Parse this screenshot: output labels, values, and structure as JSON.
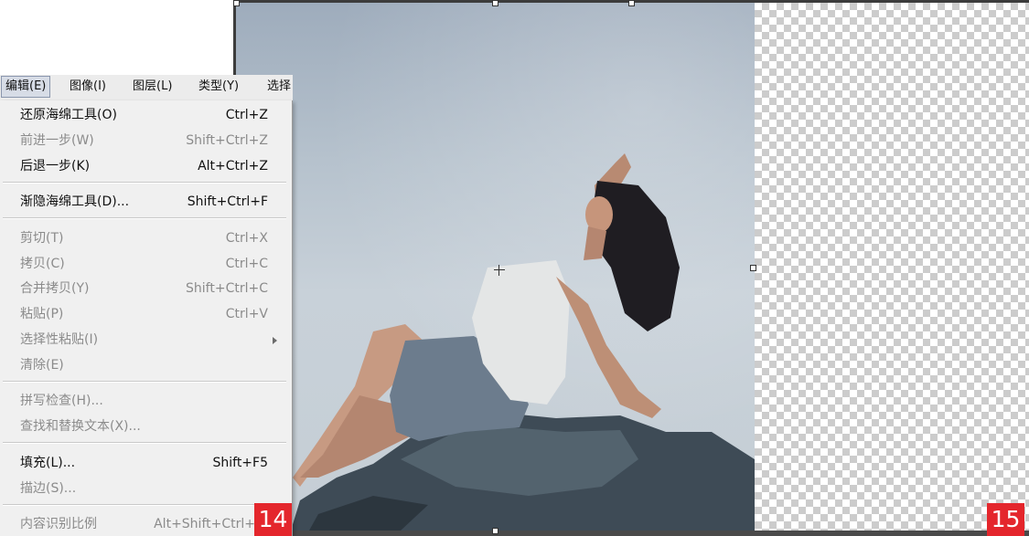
{
  "menubar": {
    "items": [
      "编辑(E)",
      "图像(I)",
      "图层(L)",
      "类型(Y)",
      "选择"
    ]
  },
  "menu": {
    "items": [
      {
        "label": "还原海绵工具(O)",
        "shortcut": "Ctrl+Z",
        "enabled": true
      },
      {
        "label": "前进一步(W)",
        "shortcut": "Shift+Ctrl+Z",
        "enabled": false
      },
      {
        "label": "后退一步(K)",
        "shortcut": "Alt+Ctrl+Z",
        "enabled": true
      },
      {
        "label": "渐隐海绵工具(D)...",
        "shortcut": "Shift+Ctrl+F",
        "enabled": true
      },
      {
        "label": "剪切(T)",
        "shortcut": "Ctrl+X",
        "enabled": false
      },
      {
        "label": "拷贝(C)",
        "shortcut": "Ctrl+C",
        "enabled": false
      },
      {
        "label": "合并拷贝(Y)",
        "shortcut": "Shift+Ctrl+C",
        "enabled": false
      },
      {
        "label": "粘贴(P)",
        "shortcut": "Ctrl+V",
        "enabled": false
      },
      {
        "label": "选择性粘贴(I)",
        "shortcut": "",
        "enabled": false
      },
      {
        "label": "清除(E)",
        "shortcut": "",
        "enabled": false
      },
      {
        "label": "拼写检查(H)...",
        "shortcut": "",
        "enabled": false
      },
      {
        "label": "查找和替换文本(X)...",
        "shortcut": "",
        "enabled": false
      },
      {
        "label": "填充(L)...",
        "shortcut": "Shift+F5",
        "enabled": true
      },
      {
        "label": "描边(S)...",
        "shortcut": "",
        "enabled": false
      },
      {
        "label": "内容识别比例",
        "shortcut": "Alt+Shift+Ctrl+",
        "enabled": false
      }
    ]
  },
  "badges": {
    "left": "14",
    "right": "15"
  },
  "icons": {
    "submenu_arrow": "chevron-right-icon",
    "crosshair": "crosshair-icon"
  }
}
